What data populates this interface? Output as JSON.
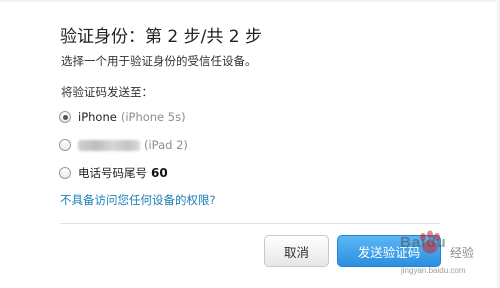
{
  "dialog": {
    "title": "验证身份：第 2 步/共 2 步",
    "instruction": "选择一个用于验证身份的受信任设备。",
    "send_to_label": "将验证码发送至：",
    "options": [
      {
        "label": "iPhone",
        "model": "(iPhone 5s)",
        "selected": true
      },
      {
        "label": "",
        "model": "(iPad 2)",
        "selected": false,
        "name_obscured": true
      },
      {
        "label": "电话号码尾号",
        "suffix": "60",
        "selected": false
      }
    ],
    "no_access_link": "不具备访问您任何设备的权限?",
    "buttons": {
      "cancel": "取消",
      "continue": "发送验证码"
    }
  },
  "watermark": {
    "brand": "Baidu",
    "text": "经验",
    "url": "jingyan.baidu.com"
  },
  "colors": {
    "link": "#1a7fb8",
    "primary_button": "#2b8fe0",
    "divider": "#e3e3e3"
  }
}
